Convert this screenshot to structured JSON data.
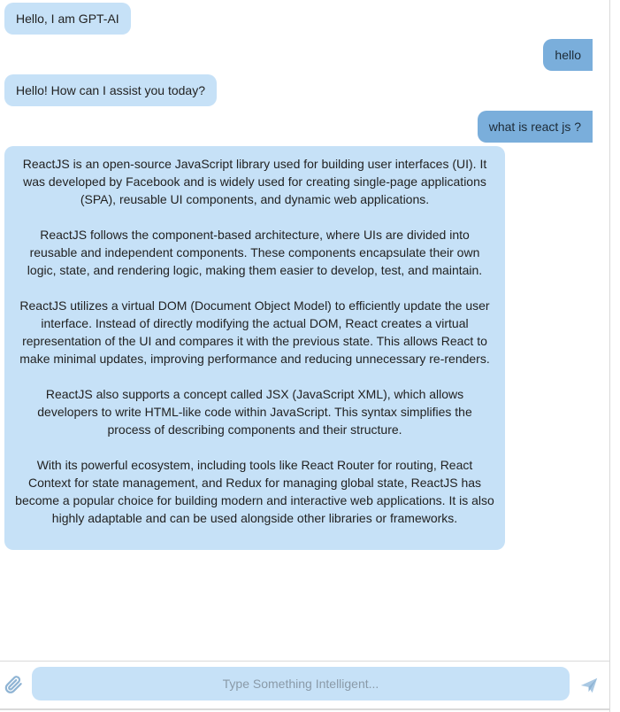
{
  "conversation": {
    "messages": [
      {
        "role": "bot",
        "text": "Hello, I am GPT-AI"
      },
      {
        "role": "user",
        "text": "hello"
      },
      {
        "role": "bot",
        "text": "Hello! How can I assist you today?"
      },
      {
        "role": "user",
        "text": "what is react js ?"
      },
      {
        "role": "bot",
        "paragraphs": [
          "ReactJS is an open-source JavaScript library used for building user interfaces (UI). It was developed by Facebook and is widely used for creating single-page applications (SPA), reusable UI components, and dynamic web applications.",
          "ReactJS follows the component-based architecture, where UIs are divided into reusable and independent components. These components encapsulate their own logic, state, and rendering logic, making them easier to develop, test, and maintain.",
          "ReactJS utilizes a virtual DOM (Document Object Model) to efficiently update the user interface. Instead of directly modifying the actual DOM, React creates a virtual representation of the UI and compares it with the previous state. This allows React to make minimal updates, improving performance and reducing unnecessary re-renders.",
          "ReactJS also supports a concept called JSX (JavaScript XML), which allows developers to write HTML-like code within JavaScript. This syntax simplifies the process of describing components and their structure.",
          "With its powerful ecosystem, including tools like React Router for routing, React Context for state management, and Redux for managing global state, ReactJS has become a popular choice for building modern and interactive web applications. It is also highly adaptable and can be used alongside other libraries or frameworks."
        ]
      }
    ]
  },
  "composer": {
    "placeholder": "Type Something Intelligent...",
    "value": "",
    "attach_icon": "paperclip-icon",
    "send_icon": "paper-plane-icon"
  },
  "colors": {
    "bot_bubble": "#c6e1f7",
    "user_bubble": "#7aaedb",
    "input_background": "#c6e1f7",
    "icon": "#8fb4d4"
  }
}
